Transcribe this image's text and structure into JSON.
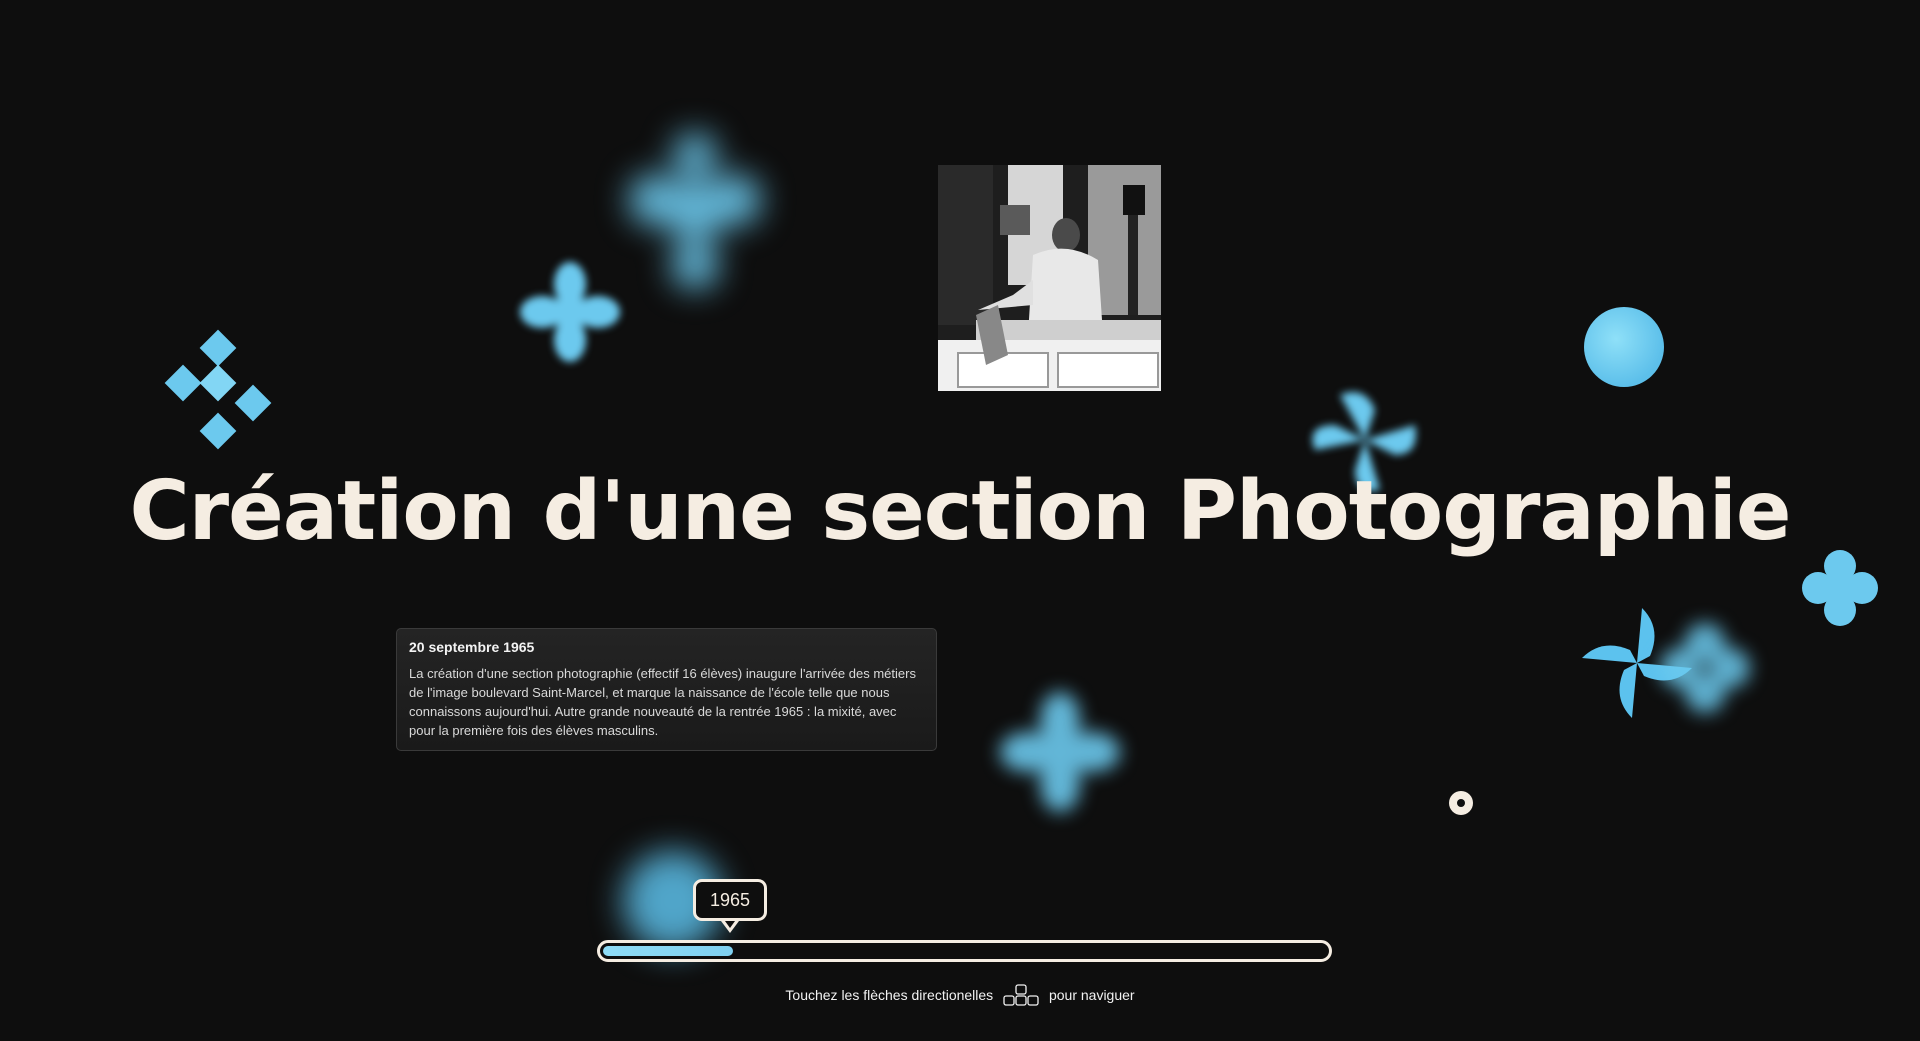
{
  "page": {
    "title": "Création d'une section Photographie"
  },
  "event": {
    "date": "20 septembre 1965",
    "description": "La création d'une section photographie (effectif 16 élèves) inaugure l'arrivée des métiers de l'image boulevard Saint-Marcel, et marque la naissance de l'école telle que nous connaissons aujourd'hui. Autre grande nouveauté de la rentrée 1965 : la mixité, avec pour la première fois des élèves masculins."
  },
  "timeline": {
    "current_year": "1965",
    "progress": 0.18
  },
  "hint": {
    "before": "Touchez les flèches directionelles",
    "after": "pour naviguer",
    "icon": "arrow-keys-icon"
  },
  "photo": {
    "description_icon": "archive-photo"
  },
  "colors": {
    "background": "#0e0e0e",
    "text": "#f5ede2",
    "accent": "#7fd0f0"
  }
}
